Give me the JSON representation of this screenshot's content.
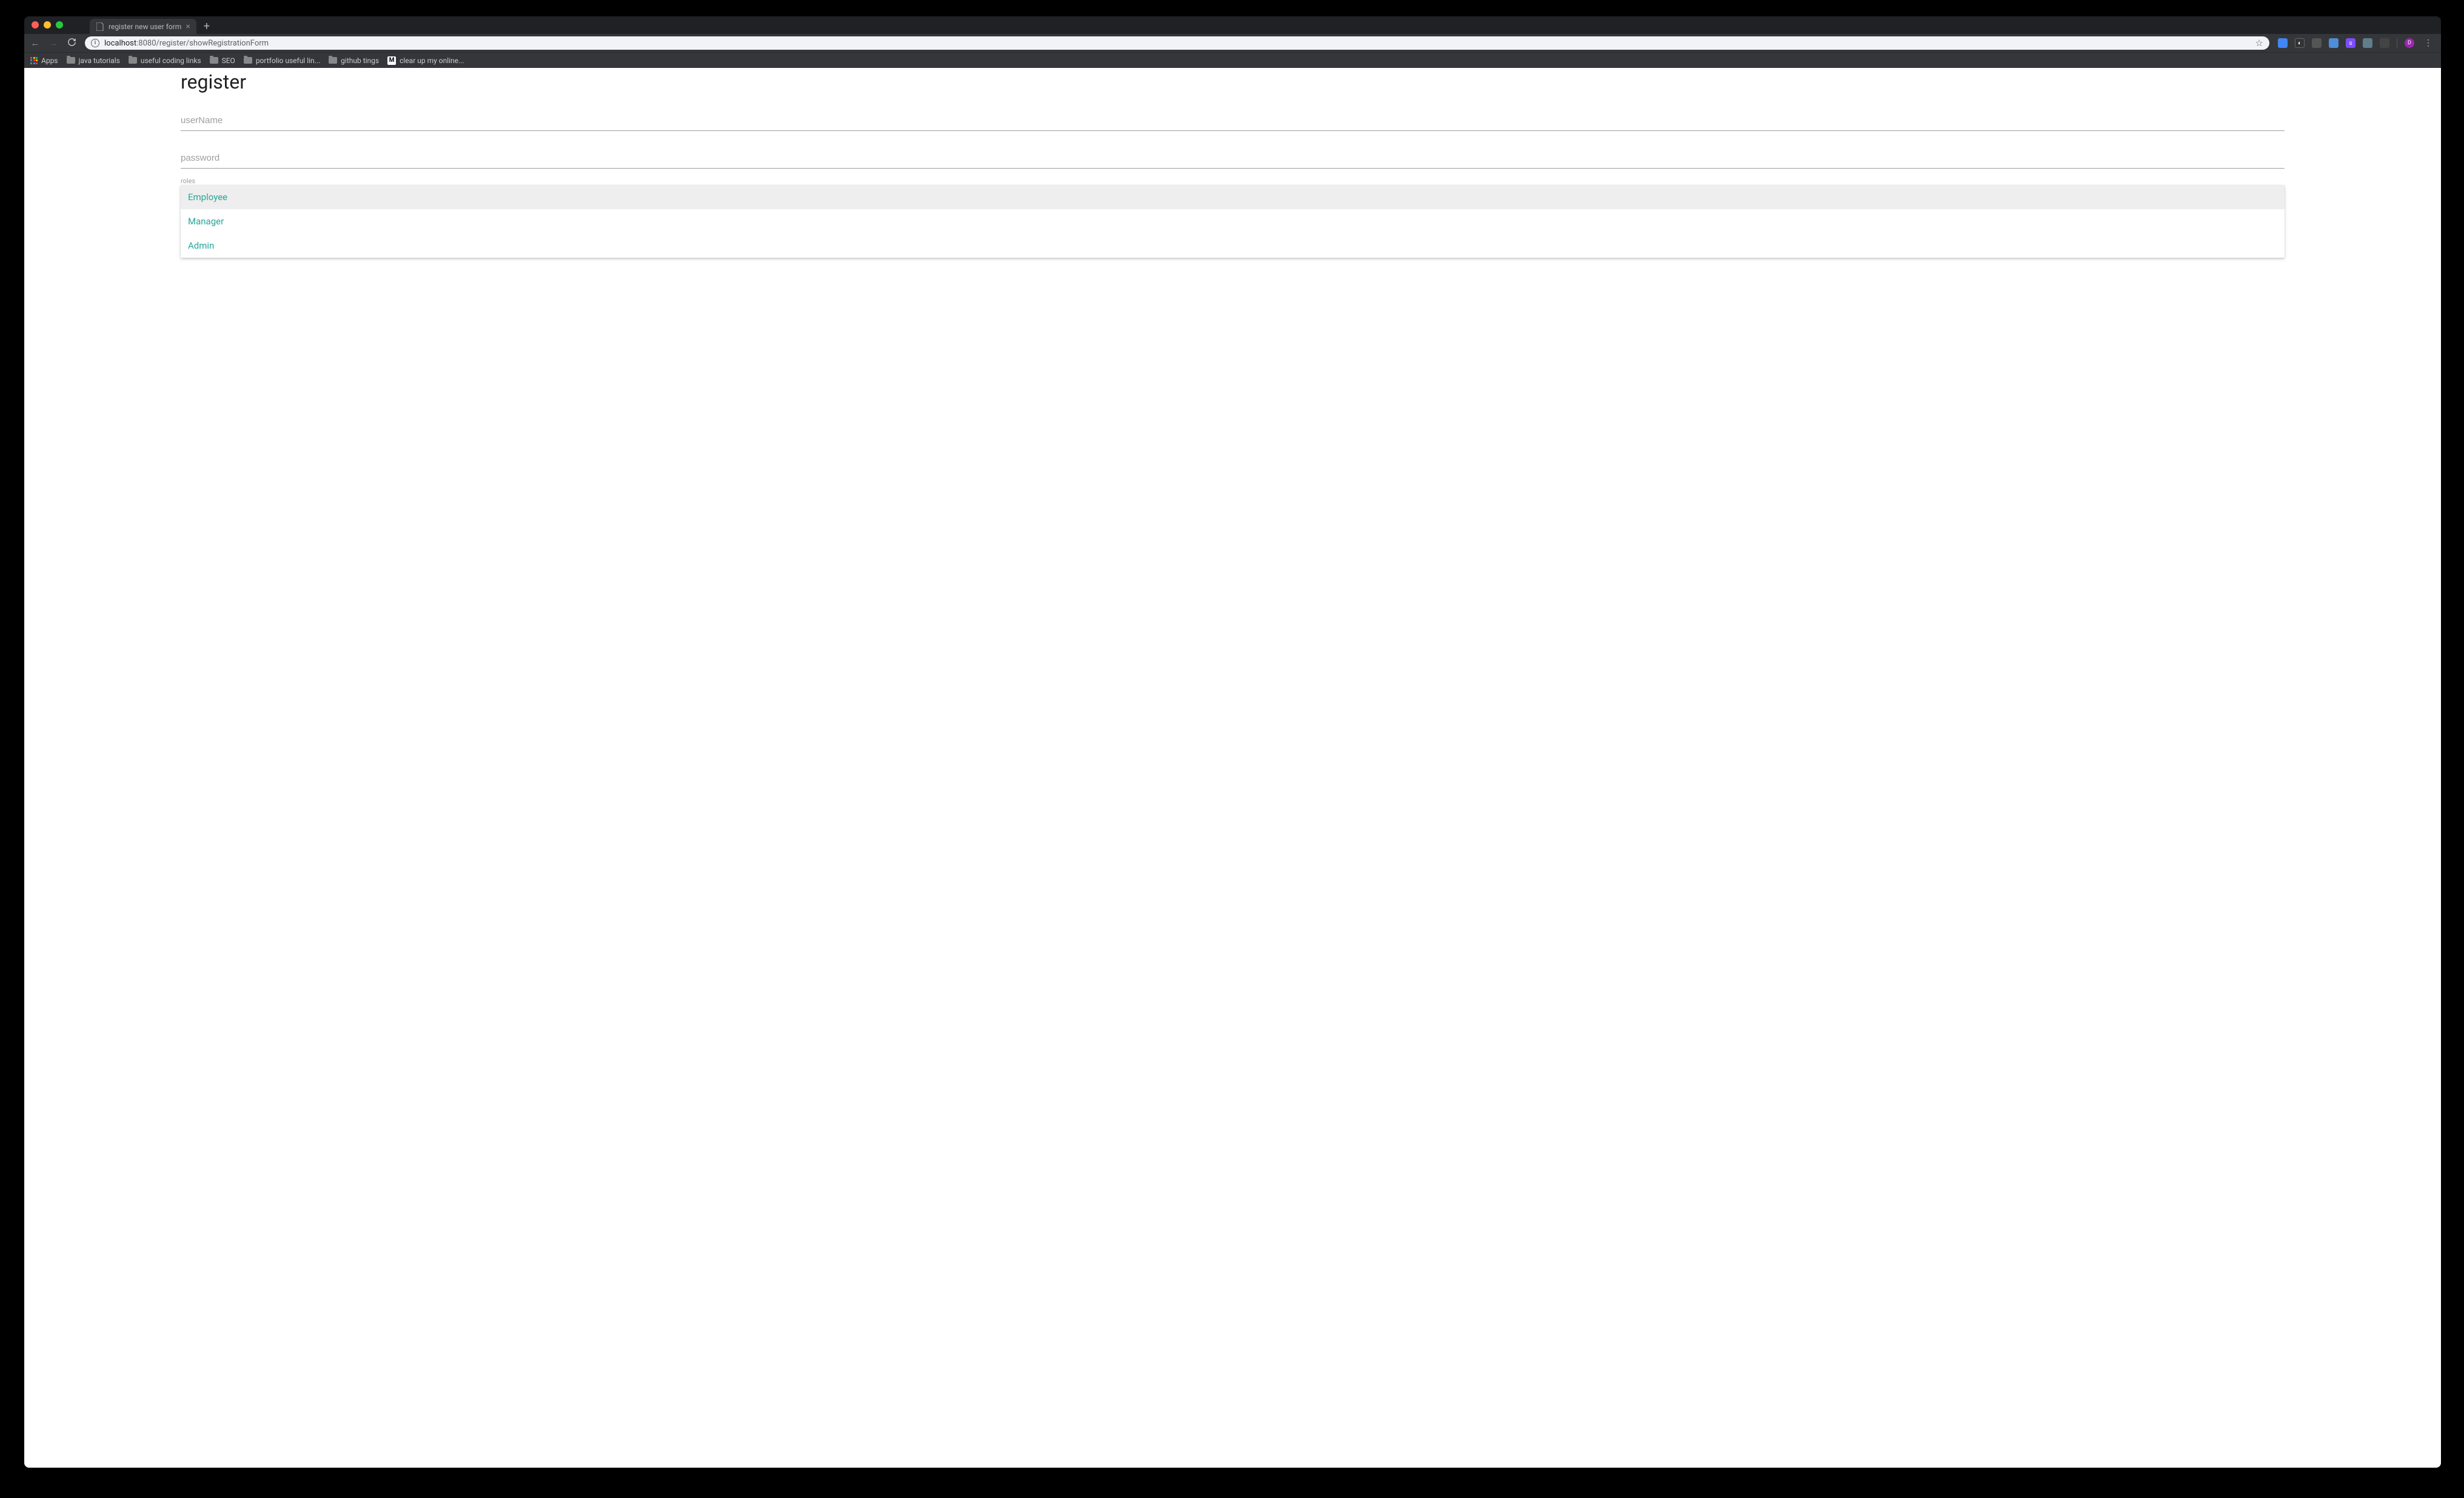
{
  "browser": {
    "tab_title": "register new user form",
    "url_host": "localhost",
    "url_port": ":8080",
    "url_path": "/register/showRegistrationForm",
    "avatar_letter": "D"
  },
  "bookmarks": {
    "apps_label": "Apps",
    "items": [
      {
        "label": "java tutorials"
      },
      {
        "label": "useful coding links"
      },
      {
        "label": "SEO"
      },
      {
        "label": "portfolio useful lin..."
      },
      {
        "label": "github tings"
      }
    ],
    "medium_label": "clear up my online..."
  },
  "page": {
    "title": "register",
    "username_placeholder": "userName",
    "password_placeholder": "password",
    "roles_label": "roles",
    "roles": [
      {
        "label": "Employee",
        "selected": true
      },
      {
        "label": "Manager",
        "selected": false
      },
      {
        "label": "Admin",
        "selected": false
      }
    ]
  }
}
